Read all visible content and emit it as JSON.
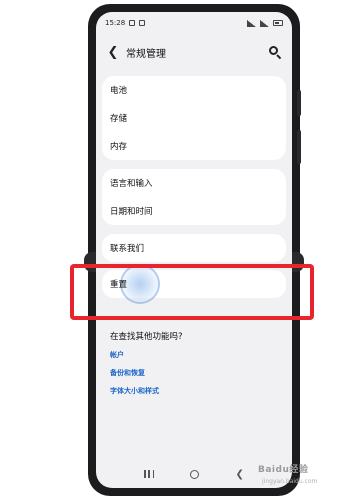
{
  "status_bar": {
    "time": "15:28"
  },
  "app_bar": {
    "title": "常规管理"
  },
  "groups": [
    {
      "items": [
        "电池",
        "存储",
        "内存"
      ]
    },
    {
      "items": [
        "语言和输入",
        "日期和时间"
      ]
    },
    {
      "items": [
        "联系我们"
      ]
    },
    {
      "items": [
        "重置"
      ]
    }
  ],
  "section": {
    "title": "在查找其他功能吗?"
  },
  "links": [
    "帐户",
    "备份和恢复",
    "字体大小和样式"
  ],
  "highlight": {
    "color": "#e8242c"
  },
  "accent_color": "#1a66c8",
  "watermark": {
    "brand": "Baidu经验",
    "sub": "jingyan.baidu.com"
  }
}
